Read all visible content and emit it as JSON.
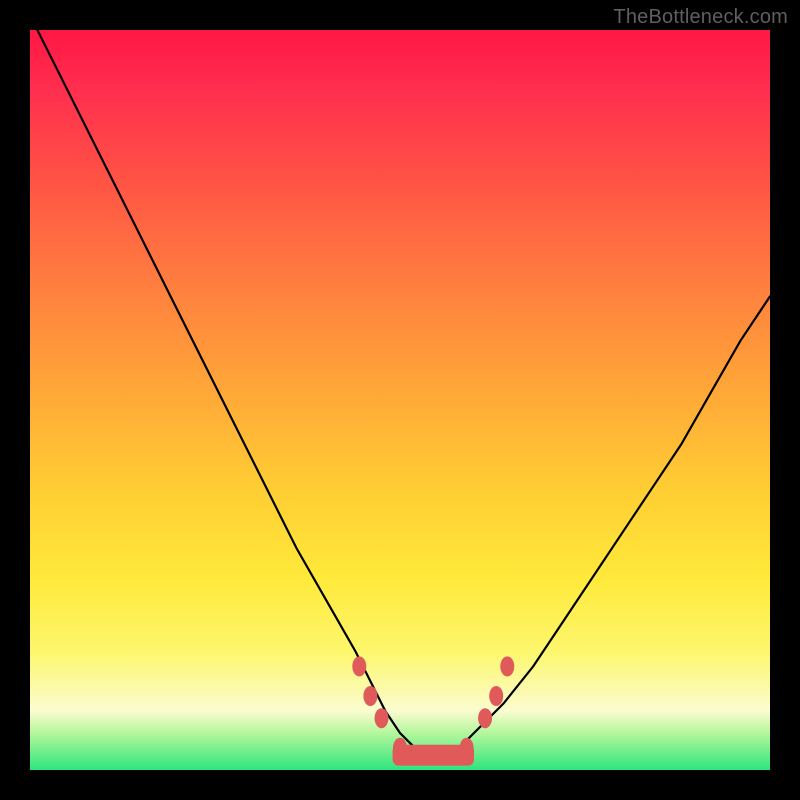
{
  "credit": "TheBottleneck.com",
  "chart_data": {
    "type": "line",
    "title": "",
    "xlabel": "",
    "ylabel": "",
    "xlim": [
      0,
      100
    ],
    "ylim": [
      0,
      100
    ],
    "series": [
      {
        "name": "curve",
        "x": [
          0,
          4,
          8,
          12,
          16,
          20,
          24,
          28,
          32,
          36,
          40,
          44,
          46,
          48,
          50,
          52,
          54,
          56,
          58,
          60,
          64,
          68,
          72,
          76,
          80,
          84,
          88,
          92,
          96,
          100
        ],
        "y": [
          102,
          94,
          86,
          78,
          70,
          62,
          54,
          46,
          38,
          30,
          23,
          16,
          12,
          8,
          5,
          3,
          2,
          2,
          3,
          5,
          9,
          14,
          20,
          26,
          32,
          38,
          44,
          51,
          58,
          64
        ]
      }
    ],
    "markers": {
      "name": "highlight-dots",
      "color": "#e05a5a",
      "points": [
        {
          "x": 44.5,
          "y": 14
        },
        {
          "x": 46.0,
          "y": 10
        },
        {
          "x": 47.5,
          "y": 7
        },
        {
          "x": 50.0,
          "y": 3
        },
        {
          "x": 53.0,
          "y": 2
        },
        {
          "x": 56.0,
          "y": 2
        },
        {
          "x": 59.0,
          "y": 3
        },
        {
          "x": 61.5,
          "y": 7
        },
        {
          "x": 63.0,
          "y": 10
        },
        {
          "x": 64.5,
          "y": 14
        }
      ]
    },
    "flat_band": {
      "name": "valley-band",
      "color": "#e05a5a",
      "x_start": 49,
      "x_end": 60,
      "y": 2,
      "thickness": 2
    }
  }
}
